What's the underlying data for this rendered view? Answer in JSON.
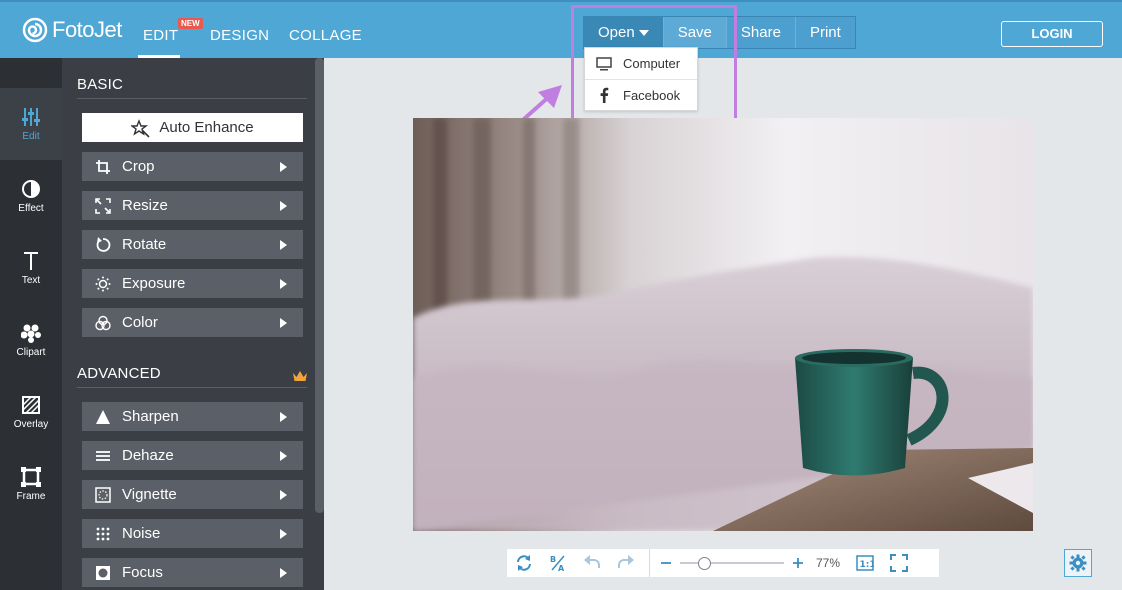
{
  "app": {
    "logo_text": "FotoJet",
    "nav": {
      "edit": "EDIT",
      "design": "DESIGN",
      "collage": "COLLAGE",
      "new_badge": "NEW"
    },
    "accent": "#4fa7d6",
    "highlight_color": "#c07fe0"
  },
  "filebar": {
    "open": "Open",
    "save": "Save",
    "share": "Share",
    "print": "Print"
  },
  "open_menu": [
    {
      "label": "Computer",
      "icon": "computer-icon"
    },
    {
      "label": "Facebook",
      "icon": "facebook-icon"
    }
  ],
  "login": "LOGIN",
  "rail": [
    {
      "label": "Edit",
      "icon": "sliders-icon",
      "active": true
    },
    {
      "label": "Effect",
      "icon": "half-circle-icon"
    },
    {
      "label": "Text",
      "icon": "text-icon"
    },
    {
      "label": "Clipart",
      "icon": "clipart-icon"
    },
    {
      "label": "Overlay",
      "icon": "overlay-icon"
    },
    {
      "label": "Frame",
      "icon": "frame-icon"
    }
  ],
  "panel": {
    "basic_title": "BASIC",
    "advanced_title": "ADVANCED",
    "auto_enhance": "Auto Enhance",
    "basic_tools": [
      "Crop",
      "Resize",
      "Rotate",
      "Exposure",
      "Color"
    ],
    "advanced_tools": [
      "Sharpen",
      "Dehaze",
      "Vignette",
      "Noise",
      "Focus"
    ]
  },
  "bottombar": {
    "zoom": "77%",
    "zoom_level": 0.77
  }
}
